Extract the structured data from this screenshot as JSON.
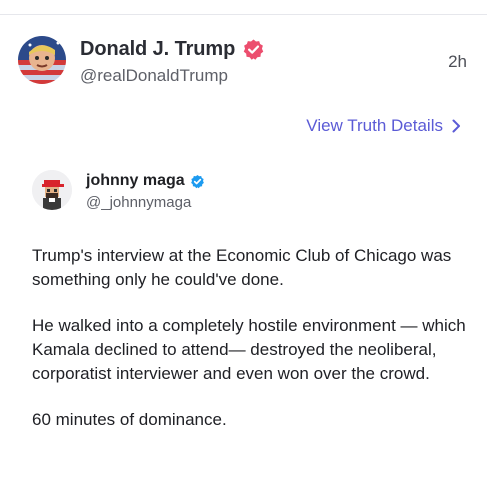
{
  "post": {
    "author_name": "Donald J. Trump",
    "author_handle": "@realDonaldTrump",
    "timestamp": "2h",
    "view_details_label": "View Truth Details"
  },
  "quoted": {
    "author_name": "johnny maga",
    "author_handle": "@_johnnymaga",
    "paragraphs": [
      "Trump's interview at the Economic Club of Chicago was something only he could've done.",
      "He walked into a completely hostile environment — which Kamala declined to attend— destroyed the neoliberal, corporatist interviewer and even won over the crowd.",
      "60 minutes of dominance."
    ]
  },
  "colors": {
    "link": "#5b5bd6",
    "verified_main": "#ec4e6e",
    "verified_quoted": "#1d9bf0"
  },
  "icons": {
    "verified_main": "verified-badge-icon",
    "verified_quoted": "verified-badge-icon",
    "chevron": "chevron-right-icon"
  }
}
